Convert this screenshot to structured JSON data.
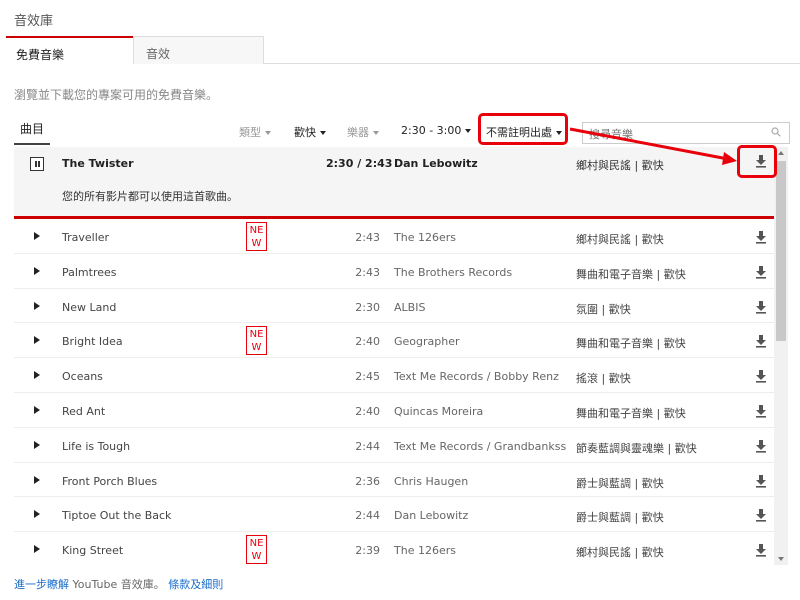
{
  "page_title": "音效庫",
  "tabs": [
    {
      "label": "免費音樂",
      "active": true
    },
    {
      "label": "音效",
      "active": false
    }
  ],
  "description": "瀏覽並下載您的專案可用的免費音樂。",
  "filters": {
    "catalog_tab": "曲目",
    "genre": "類型",
    "mood": "歡快",
    "instrument": "樂器",
    "duration": "2:30 - 3:00",
    "attribution": "不需註明出處",
    "search_placeholder": "搜尋音樂"
  },
  "now_playing": {
    "title": "The Twister",
    "time": "2:30 / 2:43",
    "artist": "Dan Lebowitz",
    "genre": "鄉村與民謠 | 歡快",
    "license_text": "您的所有影片都可以使用這首歌曲。"
  },
  "tracks": [
    {
      "title": "Traveller",
      "new": "NEW",
      "duration": "2:43",
      "artist": "The 126ers",
      "genre": "鄉村與民謠 | 歡快"
    },
    {
      "title": "Palmtrees",
      "new": "",
      "duration": "2:43",
      "artist": "The Brothers Records",
      "genre": "舞曲和電子音樂 | 歡快"
    },
    {
      "title": "New Land",
      "new": "",
      "duration": "2:30",
      "artist": "ALBIS",
      "genre": "氛圍 | 歡快"
    },
    {
      "title": "Bright Idea",
      "new": "NEW",
      "duration": "2:40",
      "artist": "Geographer",
      "genre": "舞曲和電子音樂 | 歡快"
    },
    {
      "title": "Oceans",
      "new": "",
      "duration": "2:45",
      "artist": "Text Me Records / Bobby Renz",
      "genre": "搖滾 | 歡快"
    },
    {
      "title": "Red Ant",
      "new": "",
      "duration": "2:40",
      "artist": "Quincas Moreira",
      "genre": "舞曲和電子音樂 | 歡快"
    },
    {
      "title": "Life is Tough",
      "new": "",
      "duration": "2:44",
      "artist": "Text Me Records / Grandbankss",
      "genre": "節奏藍調與靈魂樂 | 歡快"
    },
    {
      "title": "Front Porch Blues",
      "new": "",
      "duration": "2:36",
      "artist": "Chris Haugen",
      "genre": "爵士與藍調 | 歡快"
    },
    {
      "title": "Tiptoe Out the Back",
      "new": "",
      "duration": "2:44",
      "artist": "Dan Lebowitz",
      "genre": "爵士與藍調 | 歡快"
    },
    {
      "title": "King Street",
      "new": "NEW",
      "duration": "2:39",
      "artist": "The 126ers",
      "genre": "鄉村與民謠 | 歡快"
    }
  ],
  "footer": {
    "learn_more": "進一步瞭解",
    "middle": " YouTube 音效庫。 ",
    "terms": "條款及細則"
  },
  "colors": {
    "accent_red": "#cc0000",
    "annotation_red": "#e8000b",
    "link_blue": "#1a6dcc"
  },
  "icons": {
    "pause": "pause-icon",
    "play": "play-icon",
    "download": "download-icon",
    "search": "search-icon"
  }
}
